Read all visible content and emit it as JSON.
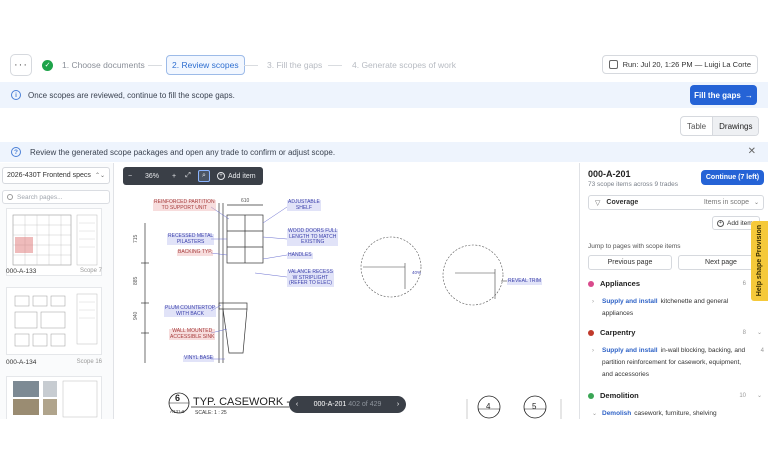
{
  "stepper": {
    "more": "···",
    "steps": [
      {
        "label": "1. Choose documents",
        "state": "done"
      },
      {
        "label": "2. Review scopes",
        "state": "active"
      },
      {
        "label": "3. Fill the gaps",
        "state": "future"
      },
      {
        "label": "4. Generate scopes of work",
        "state": "future"
      }
    ],
    "run": "Run: Jul 20, 1:26 PM — Luigi La Corte"
  },
  "banner_top": {
    "text": "Once scopes are reviewed, continue to fill the scope gaps.",
    "button": "Fill the gaps"
  },
  "view_toggle": {
    "table": "Table",
    "drawings": "Drawings",
    "selected": "Drawings"
  },
  "banner_info": {
    "text": "Review the generated scope packages and open any trade to confirm or adjust scope."
  },
  "left_panel": {
    "document": "2026-430T Frontend specs",
    "search_placeholder": "Search pages...",
    "pages": [
      {
        "name": "000-A-133",
        "scope": "Scope 7"
      },
      {
        "name": "000-A-134",
        "scope": "Scope 16"
      }
    ]
  },
  "viewer": {
    "zoom": "36%",
    "add_item": "Add item",
    "page_name": "000-A-201",
    "page_index": "402 of 429",
    "title_block": {
      "number": "6",
      "sheet": "A131-6",
      "title": "TYP. CASEWORK -",
      "scale": "SCALE: 1 : 25"
    },
    "callouts": [
      {
        "label": "REINFORCED PARTITION\nTO SUPPORT UNIT",
        "color": "red"
      },
      {
        "label": "ADJUSTABLE\nSHELF",
        "color": "blue"
      },
      {
        "label": "RECESSED METAL\nPILASTERS",
        "color": "blue"
      },
      {
        "label": "WOOD DOORS FULL\nLENGTH TO MATCH\nEXISTING",
        "color": "blue"
      },
      {
        "label": "BACKING TYP.",
        "color": "red"
      },
      {
        "label": "HANDLES",
        "color": "blue"
      },
      {
        "label": "VALANCE RECESS\nW STRIPLIGHT\n(REFER TO ELEC)",
        "color": "blue"
      },
      {
        "label": "PLUM COUNTERTOP\nWITH BACK",
        "color": "blue"
      },
      {
        "label": "WALL MOUNTED\nACCESSIBLE SINK",
        "color": "red"
      },
      {
        "label": "VINYL BASE",
        "color": "blue"
      },
      {
        "label": "REVEAL TRIM",
        "color": "blue"
      }
    ],
    "dims": [
      "610",
      "715",
      "885",
      "940"
    ],
    "details": [
      {
        "number": "4"
      },
      {
        "number": "5"
      }
    ]
  },
  "right_panel": {
    "page": "000-A-201",
    "summary": "73 scope items across 9 trades",
    "continue": "Continue (7 left)",
    "coverage_label": "Coverage",
    "coverage_value": "Items in scope",
    "add_item": "Add item",
    "jump_label": "Jump to pages with scope items",
    "prev": "Previous page",
    "next": "Next page",
    "trades": [
      {
        "name": "Appliances",
        "count": "6",
        "color": "#d94a8c",
        "items": [
          {
            "action": "Supply and install",
            "text": "kitchenette and general appliances",
            "n": ""
          }
        ]
      },
      {
        "name": "Carpentry",
        "count": "8",
        "color": "#c0392b",
        "items": [
          {
            "action": "Supply and install",
            "text": "in-wall blocking, backing, and partition reinforcement for casework, equipment, and accessories",
            "n": "4"
          }
        ]
      },
      {
        "name": "Demolition",
        "count": "10",
        "color": "#3aa655",
        "items": [
          {
            "action": "Demolish",
            "text": "casework, furniture, shelving",
            "n": ""
          }
        ]
      }
    ]
  },
  "help_tab": "Help shape Provision"
}
